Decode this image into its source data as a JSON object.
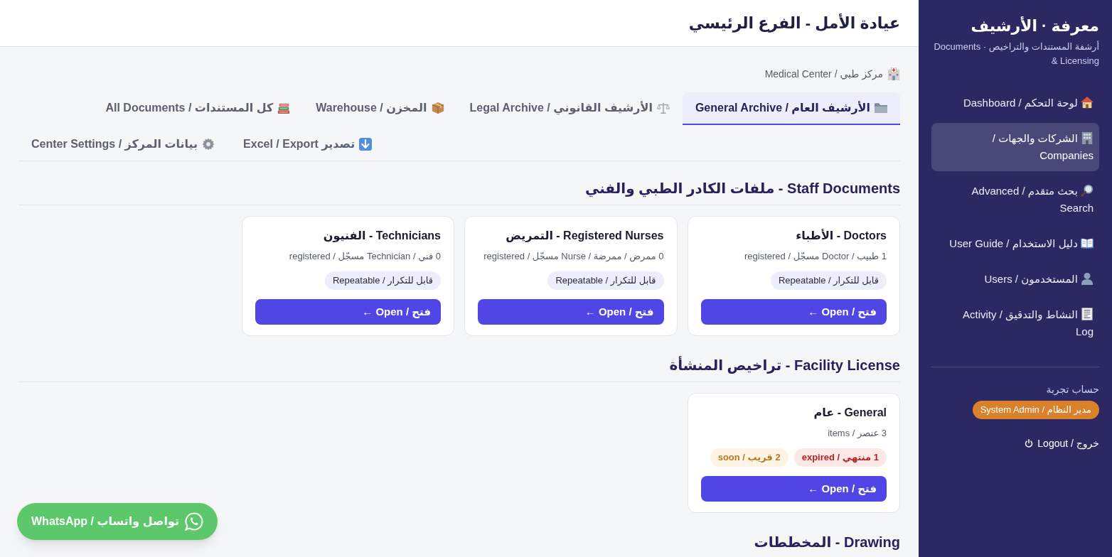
{
  "header": {
    "title": "عيادة الأمل - الفرع الرئيسي"
  },
  "breadcrumb": {
    "label": "مركز طبي / Medical Center"
  },
  "tabs": [
    {
      "label": "الأرشيف العام / General Archive",
      "selected": true
    },
    {
      "label": "الأرشيف القانوني / Legal Archive",
      "selected": false
    },
    {
      "label": "المخزن / Warehouse",
      "selected": false
    },
    {
      "label": "كل المستندات / All Documents",
      "selected": false
    }
  ],
  "actions": [
    {
      "label": "تصدير Excel / Export"
    },
    {
      "label": "بيانات المركز / Center Settings"
    }
  ],
  "sections": [
    {
      "title": "Staff Documents - ملفات الكادر الطبي والفني",
      "cards": [
        {
          "title": "Doctors - الأطباء",
          "subtitle": "1 طبيب / Doctor مسجّل / registered",
          "badges": [
            {
              "label": "قابل للتكرار / Repeatable",
              "kind": "info"
            }
          ],
          "button": "فتح / Open ←"
        },
        {
          "title": "Registered Nurses - التمريض",
          "subtitle": "0 ممرض / ممرضة / Nurse مسجّل / registered",
          "badges": [
            {
              "label": "قابل للتكرار / Repeatable",
              "kind": "info"
            }
          ],
          "button": "فتح / Open ←"
        },
        {
          "title": "Technicians - الفنيون",
          "subtitle": "0 فني / Technician مسجّل / registered",
          "badges": [
            {
              "label": "قابل للتكرار / Repeatable",
              "kind": "info"
            }
          ],
          "button": "فتح / Open ←"
        }
      ]
    },
    {
      "title": "Facility License - تراخيص المنشأة",
      "cards": [
        {
          "title": "General - عام",
          "subtitle": "3 عنصر / items",
          "badges": [
            {
              "label": "1 منتهي / expired",
              "kind": "danger"
            },
            {
              "label": "2 قريب / soon",
              "kind": "warning"
            }
          ],
          "button": "فتح / Open ←"
        }
      ]
    },
    {
      "title": "Drawing - المخططات"
    }
  ],
  "sidebar": {
    "brand": "معرفة · الأرشيف",
    "tagline": "أرشفة المستندات والتراخيص · Documents & Licensing",
    "items": [
      {
        "label": "لوحة التحكم / Dashboard",
        "selected": false
      },
      {
        "label": "الشركات والجهات / Companies",
        "selected": true
      },
      {
        "label": "بحث متقدم / Advanced Search",
        "selected": false
      },
      {
        "label": "دليل الاستخدام / User Guide",
        "selected": false
      },
      {
        "label": "المستخدمون / Users",
        "selected": false
      },
      {
        "label": "النشاط والتدقيق / Activity Log",
        "selected": false
      }
    ],
    "account": {
      "name": "حساب تجربة",
      "role": "مدير النظام / System Admin",
      "logout": "خروج / Logout"
    }
  },
  "whatsapp": {
    "label": "تواصل واتساب / WhatsApp"
  }
}
